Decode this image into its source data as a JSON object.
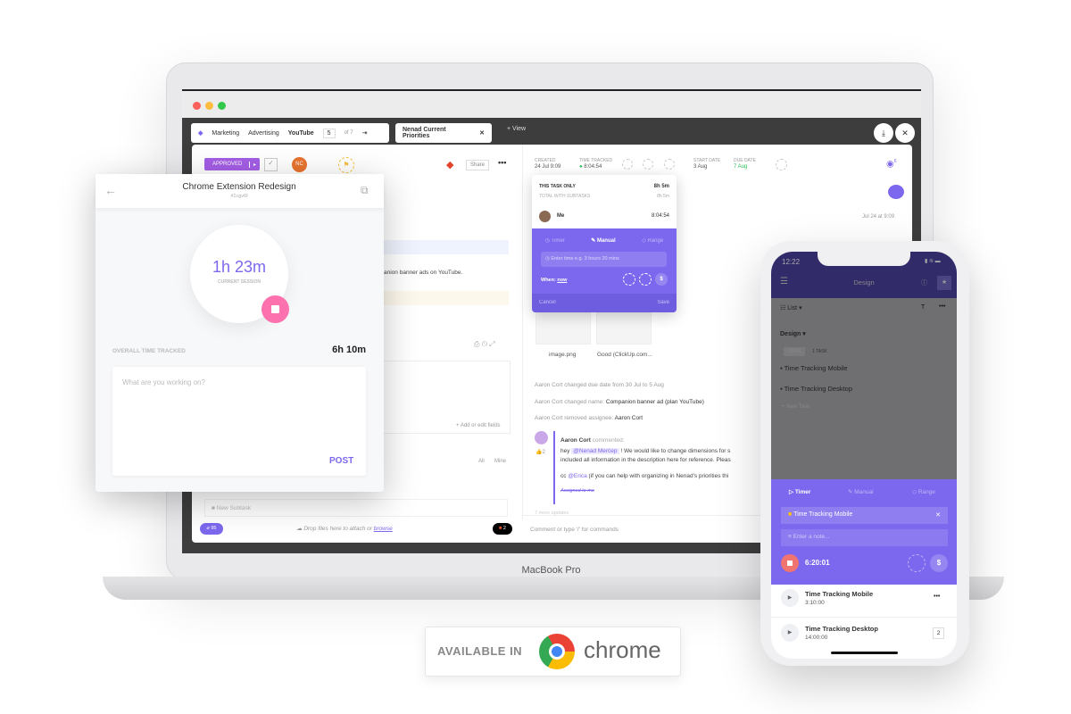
{
  "laptop": {
    "model": "MacBook Pro"
  },
  "breadcrumb": {
    "items": [
      "Marketing",
      "Advertising",
      "YouTube"
    ],
    "page": "5",
    "of": "of 7",
    "view_tab": "Nenad Current Priorities",
    "add_view": "+ View"
  },
  "task": {
    "status": "APPROVED",
    "assignee_initials": "NC",
    "share": "Share",
    "created_label": "CREATED",
    "created": "24 Jul 9:09",
    "tracked_label": "TIME TRACKED",
    "tracked": "8:04:54",
    "start_label": "START DATE",
    "start": "3 Aug",
    "due_label": "DUE DATE",
    "due": "7 Aug",
    "watchers": "6",
    "description_snippet": "anion banner ads on YouTube.",
    "add_fields": "+ Add or edit fields",
    "filter_all": "All",
    "filter_mine": "Mine",
    "new_subtask": "New Subtask",
    "attachments_count": "95",
    "drop_text": "Drop files here to attach or",
    "browse": "browse",
    "figma_count": "2",
    "comment_placeholder": "Comment or type '/' for commands",
    "activity_time": "Jul 24 at 9:09",
    "files": [
      "image.png",
      "Good (ClickUp.com..."
    ],
    "activity": [
      "Aaron Cort changed due date from 30 Jul to 5 Aug",
      "Aaron Cort changed name:",
      "Companion banner ad (plan YouTube)",
      "Aaron Cort removed assignee:",
      "Aaron Cort"
    ],
    "comment": {
      "author": "Aaron Cort",
      "verb": "commented:",
      "likes": "2",
      "line1_pre": "hey",
      "mention": "@Nenad Merćep",
      "line1_post": "! We would like to change dimensions for s",
      "line2": "included all information in the description here for reference. Pleas",
      "line3_pre": "cc",
      "mention2": "@Erica",
      "line3_post": "(if you can help with organizing in Nenad's priorities thi",
      "assigned": "Assigned to me"
    },
    "more_updates": "7 more updates"
  },
  "time_popup": {
    "this_task_label": "THIS TASK ONLY",
    "this_task": "8h 5m",
    "subtasks_label": "TOTAL WITH SUBTASKS",
    "subtasks": "8h 5m",
    "user": "Me",
    "user_time": "8:04:54",
    "tabs": [
      "Timer",
      "Manual",
      "Range"
    ],
    "placeholder": "Enter time e.g. 3 hours 20 mins",
    "when_label": "When:",
    "when_value": "now",
    "cancel": "Cancel",
    "save": "Save"
  },
  "extension": {
    "title": "Chrome Extension Redesign",
    "task_id": "#1cgv6f",
    "session": "1h 23m",
    "session_label": "CURRENT SESSION",
    "overall_label": "OVERALL TIME TRACKED",
    "overall": "6h 10m",
    "placeholder": "What are you working on?",
    "post": "POST"
  },
  "phone": {
    "time": "12:22",
    "title": "Design",
    "view": "List",
    "list_name": "Design",
    "status": "OPEN",
    "task_count": "1 TASK",
    "tasks": [
      "Time Tracking Mobile",
      "Time Tracking Desktop"
    ],
    "new_task": "+ New Task",
    "tabs": [
      "Timer",
      "Manual",
      "Range"
    ],
    "current_task": "Time Tracking Mobile",
    "note_placeholder": "Enter a note...",
    "timer": "6:20:01",
    "entries": [
      {
        "name": "Time Tracking Mobile",
        "time": "3:10:00"
      },
      {
        "name": "Time Tracking Desktop",
        "time": "14:00:00",
        "badge": "2"
      }
    ]
  },
  "badge": {
    "available": "AVAILABLE IN",
    "chrome": "chrome"
  },
  "colors": {
    "accent": "#7b68ee",
    "approved": "#a45ee5",
    "stop": "#fd71af",
    "phone_header": "#322b6a"
  }
}
